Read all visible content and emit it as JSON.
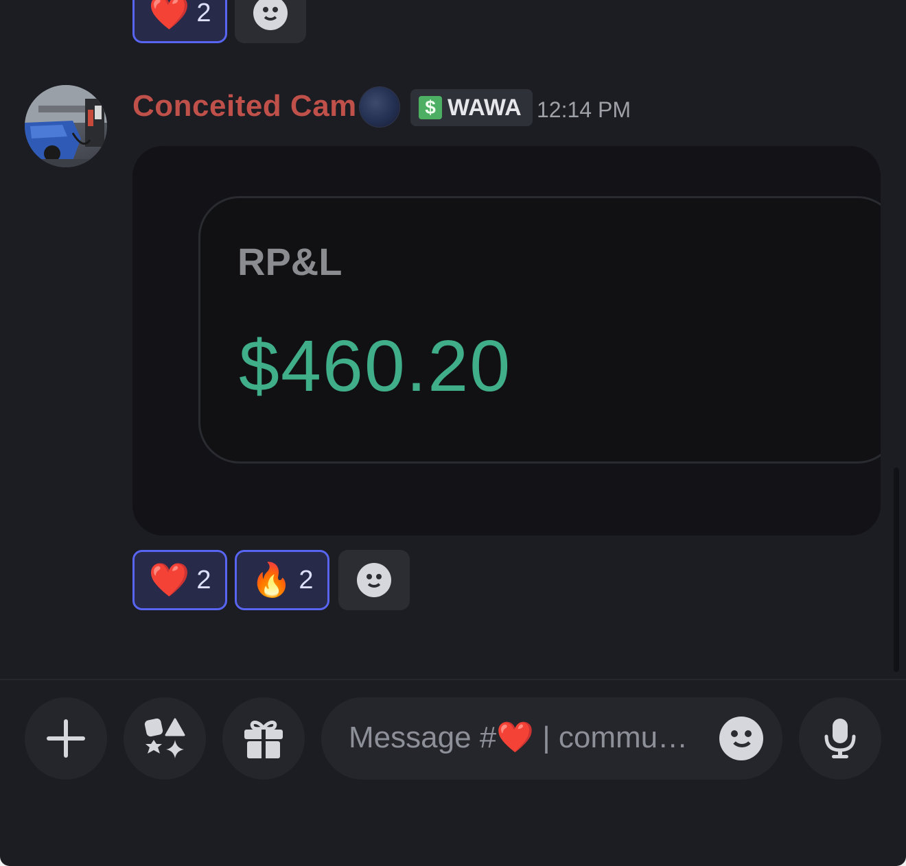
{
  "top_reactions": [
    {
      "emoji": "❤️",
      "count": "2"
    }
  ],
  "message": {
    "username": "Conceited Cam",
    "username_color": "#c0504a",
    "tag": {
      "icon": "$",
      "label": "WAWA"
    },
    "timestamp": "12:14 PM",
    "image": {
      "label": "RP&L",
      "value": "$460.20",
      "value_color": "#3fae89"
    },
    "reactions": [
      {
        "emoji": "❤️",
        "count": "2"
      },
      {
        "emoji": "🔥",
        "count": "2"
      }
    ]
  },
  "composer": {
    "placeholder": "Message #❤️ | commu…"
  },
  "colors": {
    "background": "#1c1d22",
    "accent": "#5865f2",
    "reaction_active_bg": "#272a48"
  },
  "icons": {
    "add": "plus-icon",
    "apps": "apps-icon",
    "gift": "gift-icon",
    "emoji": "smiley-face-icon",
    "mic": "microphone-icon"
  }
}
